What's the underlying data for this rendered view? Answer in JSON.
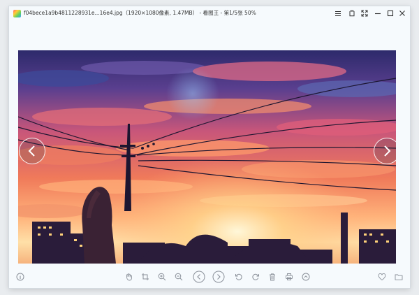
{
  "window": {
    "title": "f04bece1a9b4811228931e...16e4.jpg（1920×1080像素, 1.47MB） - 看图王 - 第1/5张 50%",
    "controls": [
      "menu-icon",
      "skin-icon",
      "fullscreen-icon",
      "minimize-icon",
      "maximize-icon",
      "close-icon"
    ]
  },
  "viewer": {
    "image_description_icon": "photo",
    "prev_arrow": "chevron-left-icon",
    "next_arrow": "chevron-right-icon"
  },
  "toolbar": {
    "left": [
      "info-icon"
    ],
    "center": [
      "hand-icon",
      "crop-icon",
      "zoom-in-icon",
      "zoom-out-icon",
      "prev-icon",
      "next-icon",
      "rotate-left-icon",
      "rotate-right-icon",
      "delete-icon",
      "print-icon",
      "more-icon"
    ],
    "right": [
      "heart-icon",
      "folder-icon"
    ]
  },
  "colors": {
    "window_bg": "#f6fafd",
    "icon": "#8a9099"
  }
}
